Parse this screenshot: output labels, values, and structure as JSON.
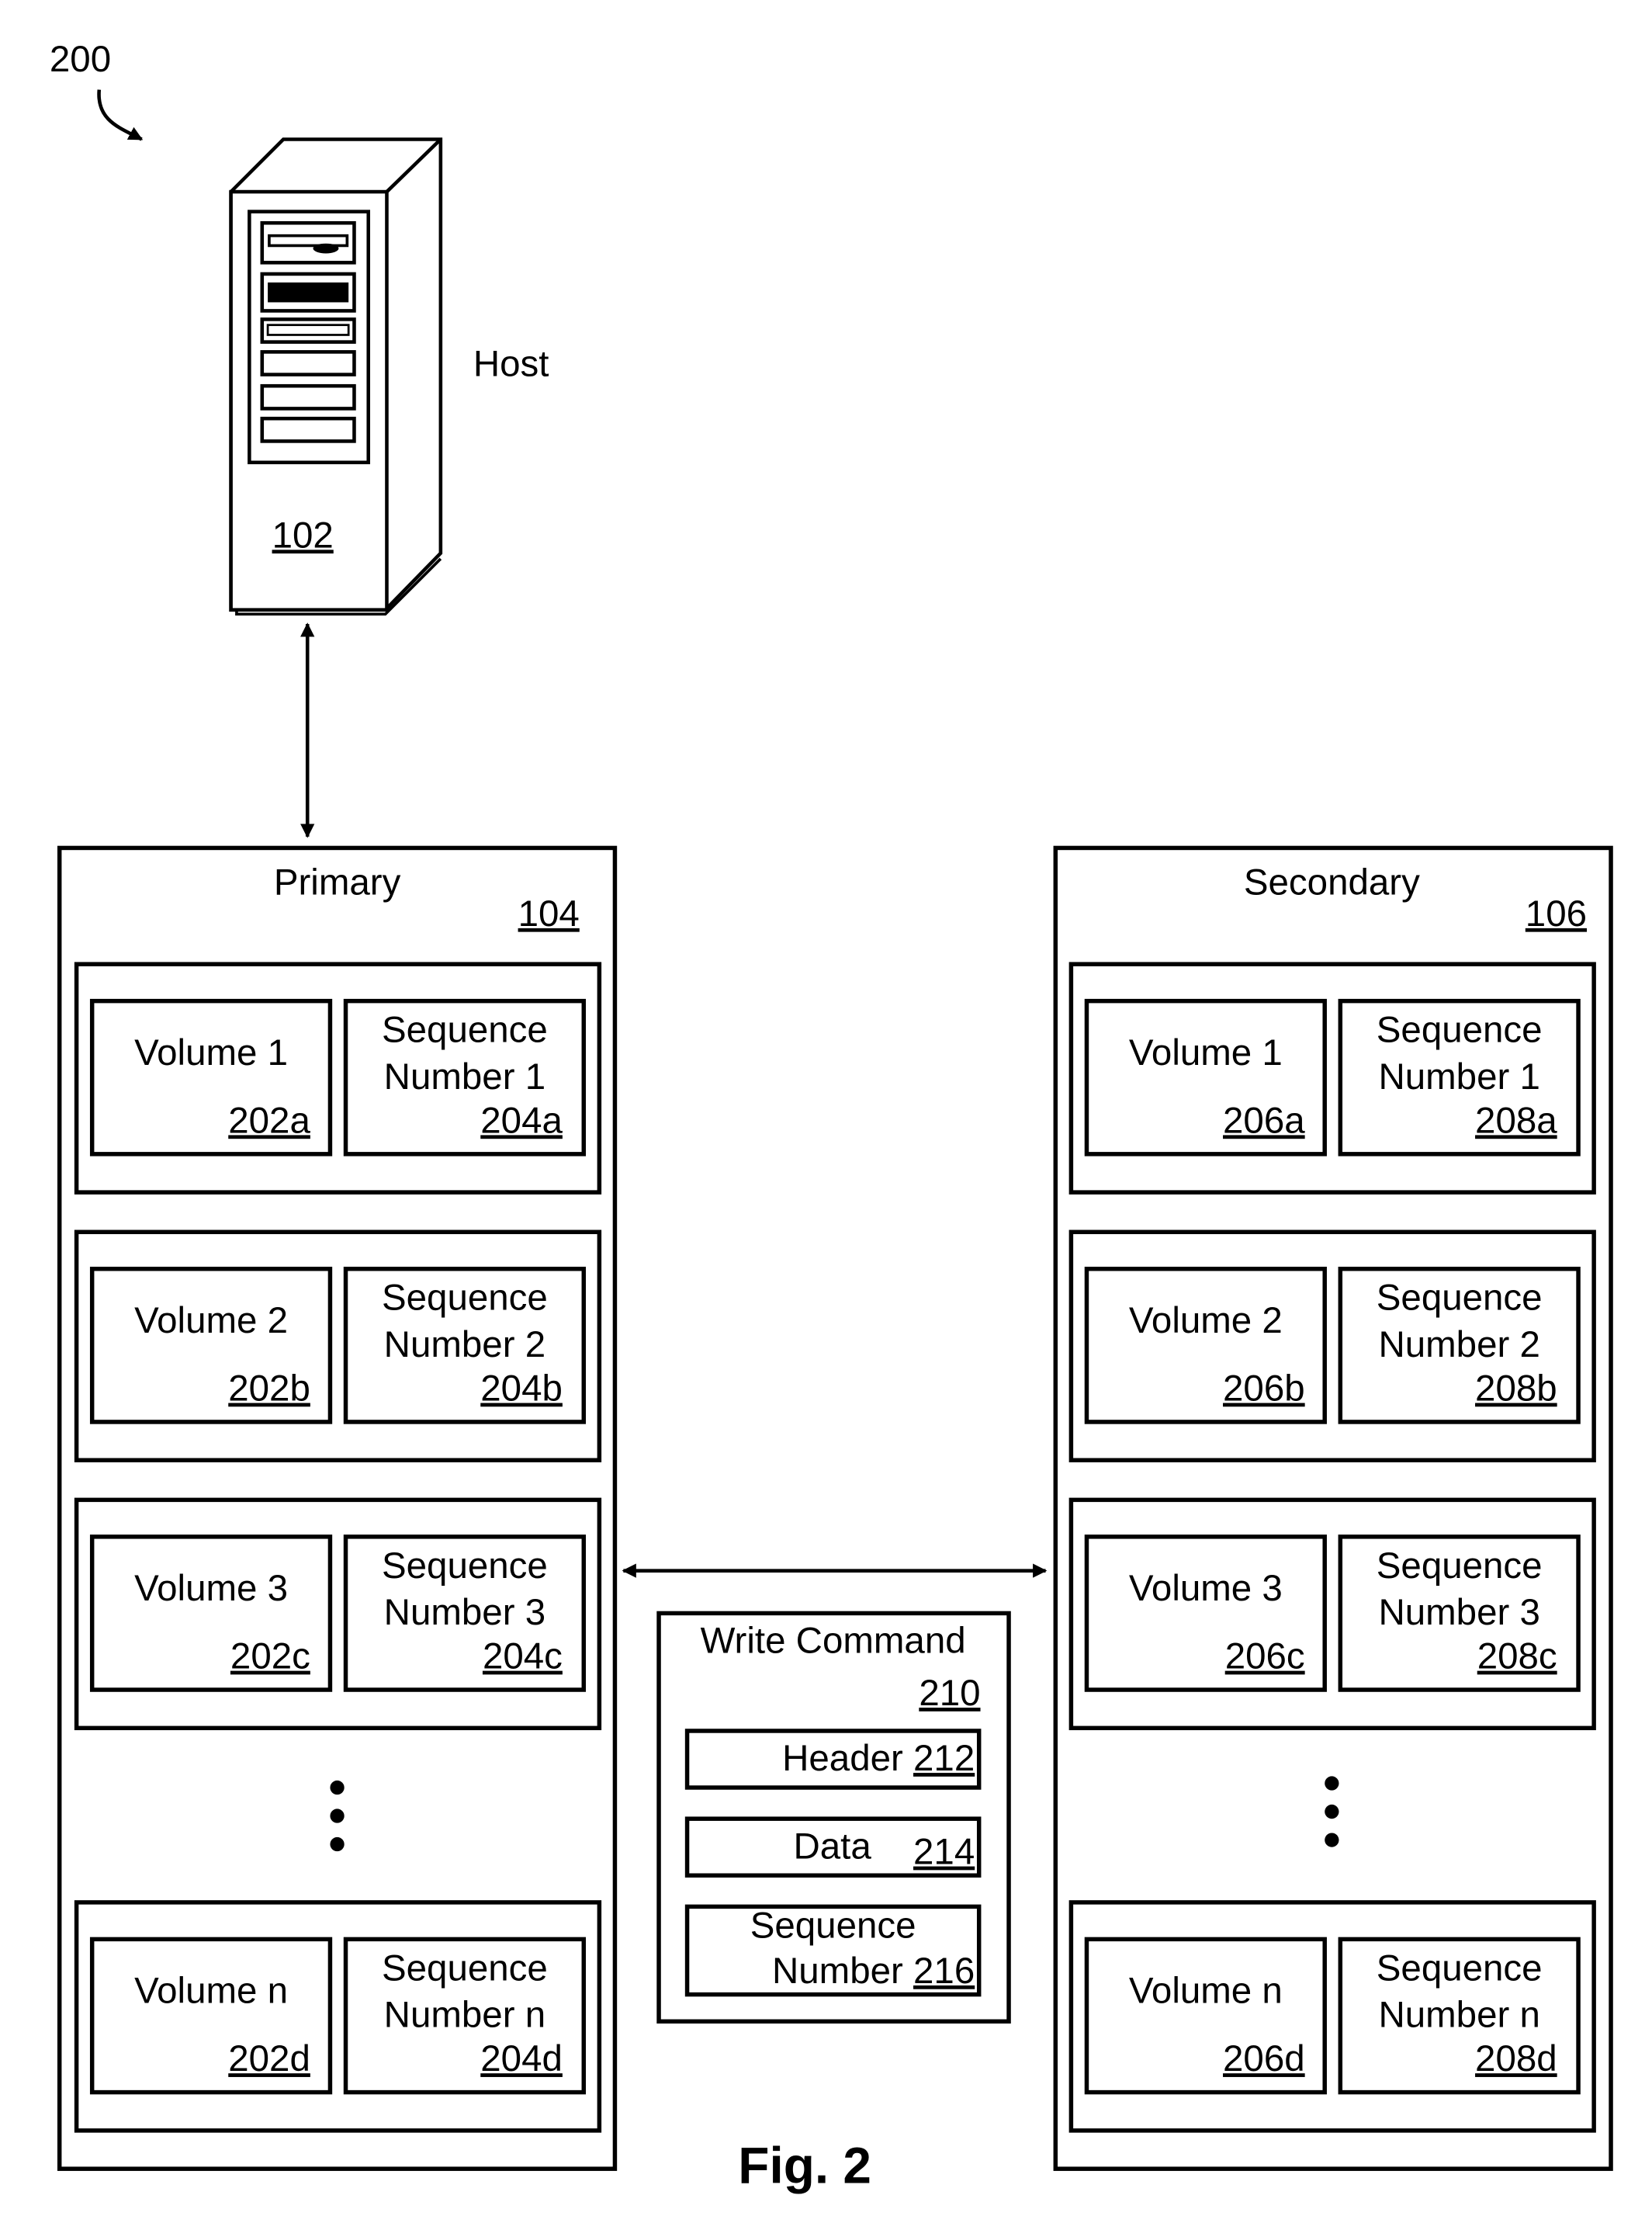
{
  "figure": {
    "ref": "200",
    "caption": "Fig. 2"
  },
  "host": {
    "label": "Host",
    "ref": "102"
  },
  "primary": {
    "label": "Primary",
    "ref": "104",
    "rows": [
      {
        "volume": "Volume 1",
        "volume_ref": "202a",
        "seq_line1": "Sequence",
        "seq_line2": "Number 1",
        "seq_ref": "204a"
      },
      {
        "volume": "Volume 2",
        "volume_ref": "202b",
        "seq_line1": "Sequence",
        "seq_line2": "Number 2",
        "seq_ref": "204b"
      },
      {
        "volume": "Volume 3",
        "volume_ref": "202c",
        "seq_line1": "Sequence",
        "seq_line2": "Number 3",
        "seq_ref": "204c"
      },
      {
        "volume": "Volume n",
        "volume_ref": "202d",
        "seq_line1": "Sequence",
        "seq_line2": "Number n",
        "seq_ref": "204d"
      }
    ]
  },
  "secondary": {
    "label": "Secondary",
    "ref": "106",
    "rows": [
      {
        "volume": "Volume 1",
        "volume_ref": "206a",
        "seq_line1": "Sequence",
        "seq_line2": "Number 1",
        "seq_ref": "208a"
      },
      {
        "volume": "Volume 2",
        "volume_ref": "206b",
        "seq_line1": "Sequence",
        "seq_line2": "Number 2",
        "seq_ref": "208b"
      },
      {
        "volume": "Volume 3",
        "volume_ref": "206c",
        "seq_line1": "Sequence",
        "seq_line2": "Number 3",
        "seq_ref": "208c"
      },
      {
        "volume": "Volume n",
        "volume_ref": "206d",
        "seq_line1": "Sequence",
        "seq_line2": "Number n",
        "seq_ref": "208d"
      }
    ]
  },
  "write_command": {
    "label": "Write Command",
    "ref": "210",
    "header_label": "Header",
    "header_ref": "212",
    "data_label": "Data",
    "data_ref": "214",
    "seq_line1": "Sequence",
    "seq_line2": "Number",
    "seq_ref": "216"
  }
}
